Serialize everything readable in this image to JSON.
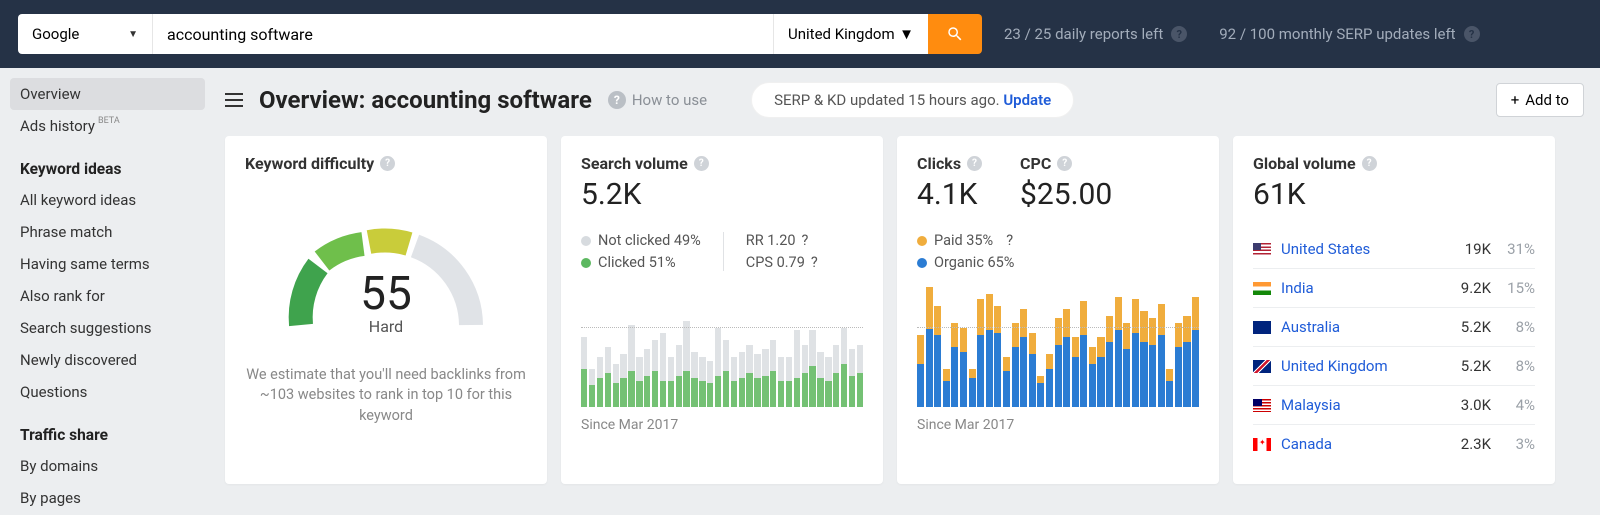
{
  "topbar": {
    "engine": "Google",
    "query": "accounting software",
    "country": "United Kingdom",
    "daily_reports": "23 / 25 daily reports left",
    "monthly_serp": "92 / 100 monthly SERP updates left"
  },
  "sidebar": {
    "items": [
      {
        "label": "Overview",
        "active": true
      },
      {
        "label": "Ads history",
        "beta": "BETA"
      }
    ],
    "section1_title": "Keyword ideas",
    "section1": [
      {
        "label": "All keyword ideas"
      },
      {
        "label": "Phrase match"
      },
      {
        "label": "Having same terms"
      },
      {
        "label": "Also rank for"
      },
      {
        "label": "Search suggestions"
      },
      {
        "label": "Newly discovered"
      },
      {
        "label": "Questions"
      }
    ],
    "section2_title": "Traffic share",
    "section2": [
      {
        "label": "By domains"
      },
      {
        "label": "By pages"
      }
    ]
  },
  "header": {
    "title": "Overview: accounting software",
    "how_to": "How to use",
    "update_text": "SERP & KD updated 15 hours ago. ",
    "update_link": "Update",
    "add_btn": "Add to"
  },
  "kd_card": {
    "title": "Keyword difficulty",
    "score": "55",
    "label": "Hard",
    "note": "We estimate that you'll need backlinks from ~103 websites to rank in top 10 for this keyword"
  },
  "sv_card": {
    "title": "Search volume",
    "value": "5.2K",
    "not_clicked": "Not clicked 49%",
    "clicked": "Clicked 51%",
    "rr": "RR 1.20",
    "cps": "CPS 0.79",
    "since": "Since Mar 2017"
  },
  "cc_card": {
    "clicks_title": "Clicks",
    "clicks_value": "4.1K",
    "cpc_title": "CPC",
    "cpc_value": "$25.00",
    "paid": "Paid 35%",
    "organic": "Organic 65%",
    "since": "Since Mar 2017"
  },
  "gv_card": {
    "title": "Global volume",
    "value": "61K",
    "rows": [
      {
        "flag": "us",
        "country": "United States",
        "vol": "19K",
        "pct": "31%"
      },
      {
        "flag": "in",
        "country": "India",
        "vol": "9.2K",
        "pct": "15%"
      },
      {
        "flag": "au",
        "country": "Australia",
        "vol": "5.2K",
        "pct": "8%"
      },
      {
        "flag": "uk",
        "country": "United Kingdom",
        "vol": "5.2K",
        "pct": "8%"
      },
      {
        "flag": "my",
        "country": "Malaysia",
        "vol": "3.0K",
        "pct": "4%"
      },
      {
        "flag": "ca",
        "country": "Canada",
        "vol": "2.3K",
        "pct": "3%"
      }
    ]
  },
  "chart_data": [
    {
      "type": "bar",
      "title": "Search volume — stacked not-clicked/clicked",
      "stacked": true,
      "series": [
        {
          "name": "Clicked",
          "color": "#74c174",
          "values": [
            32,
            18,
            24,
            28,
            20,
            24,
            30,
            22,
            26,
            30,
            22,
            22,
            26,
            30,
            24,
            22,
            20,
            26,
            30,
            22,
            24,
            28,
            24,
            26,
            30,
            22,
            22,
            24,
            28,
            34,
            24,
            22,
            28,
            36,
            26,
            28
          ]
        },
        {
          "name": "Not clicked",
          "color": "#dfe2e5",
          "values": [
            26,
            14,
            18,
            22,
            16,
            20,
            38,
            20,
            22,
            26,
            40,
            20,
            26,
            42,
            22,
            20,
            18,
            40,
            26,
            20,
            22,
            24,
            20,
            22,
            26,
            20,
            20,
            40,
            24,
            30,
            22,
            20,
            24,
            30,
            22,
            24
          ]
        }
      ]
    },
    {
      "type": "bar",
      "title": "Clicks — stacked paid/organic",
      "stacked": true,
      "series": [
        {
          "name": "Organic",
          "color": "#2b7cd3",
          "values": [
            36,
            78,
            60,
            22,
            50,
            46,
            24,
            60,
            64,
            62,
            30,
            50,
            58,
            44,
            20,
            32,
            52,
            58,
            42,
            60,
            36,
            42,
            54,
            64,
            48,
            62,
            54,
            52,
            60,
            22,
            50,
            54,
            64
          ]
        },
        {
          "name": "Paid",
          "color": "#f0ad3d",
          "values": [
            24,
            42,
            24,
            10,
            20,
            20,
            8,
            30,
            30,
            22,
            12,
            20,
            24,
            18,
            6,
            12,
            22,
            24,
            16,
            28,
            14,
            16,
            22,
            28,
            22,
            28,
            26,
            22,
            26,
            10,
            20,
            22,
            28
          ]
        }
      ]
    }
  ]
}
